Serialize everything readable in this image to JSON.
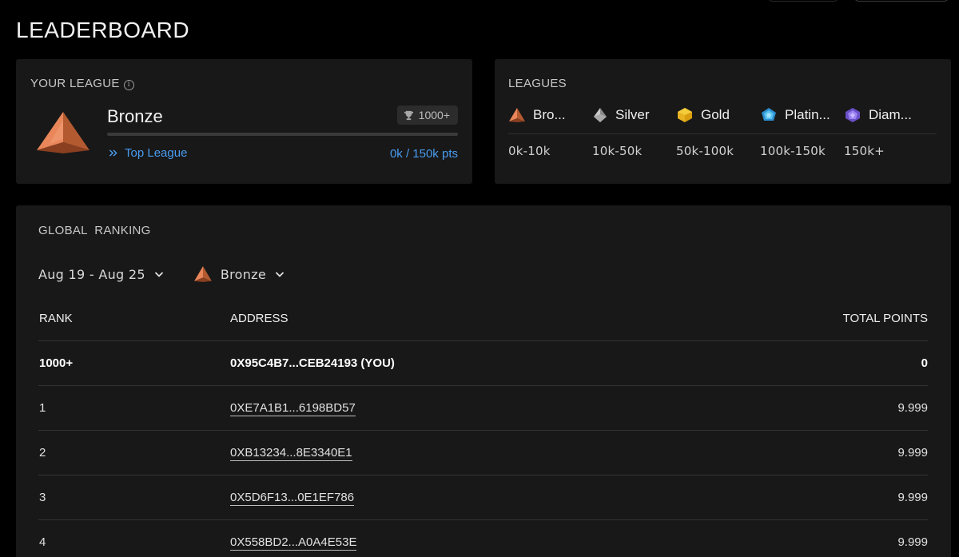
{
  "page": {
    "title": "LEADERBOARD"
  },
  "your_league": {
    "label": "YOUR LEAGUE",
    "info_icon": "info-icon",
    "league": "Bronze",
    "rank": "1000+",
    "rank_icon": "trophy-icon",
    "progress_fraction": 0,
    "top_league_label": "Top League",
    "points": "0k / 150k pts"
  },
  "leagues": {
    "label": "LEAGUES",
    "items": [
      {
        "name": "Bro...",
        "range": "0k-10k",
        "icon": "bronze-pyramid-icon"
      },
      {
        "name": "Silver",
        "range": "10k-50k",
        "icon": "silver-octahedron-icon"
      },
      {
        "name": "Gold",
        "range": "50k-100k",
        "icon": "gold-gem-icon"
      },
      {
        "name": "Platin...",
        "range": "100k-150k",
        "icon": "platinum-gem-icon"
      },
      {
        "name": "Diam...",
        "range": "150k+",
        "icon": "diamond-gem-icon"
      }
    ]
  },
  "ranking": {
    "label": "GLOBAL  RANKING",
    "date_filter": "Aug 19 - Aug 25",
    "league_filter": "Bronze",
    "columns": {
      "rank": "RANK",
      "address": "ADDRESS",
      "points": "TOTAL POINTS"
    },
    "me": {
      "rank": "1000+",
      "address": "0X95C4B7...CEB24193 (YOU)",
      "points": "0"
    },
    "rows": [
      {
        "rank": "1",
        "address": "0XE7A1B1...6198BD57",
        "points": "9.999"
      },
      {
        "rank": "2",
        "address": "0XB13234...8E3340E1",
        "points": "9.999"
      },
      {
        "rank": "3",
        "address": "0X5D6F13...0E1EF786",
        "points": "9.999"
      },
      {
        "rank": "4",
        "address": "0X558BD2...A0A4E53E",
        "points": "9.999"
      }
    ]
  },
  "colors": {
    "accent": "#4a9cf0",
    "bronze": "#e07a45",
    "card": "#181818",
    "background": "#000000"
  }
}
